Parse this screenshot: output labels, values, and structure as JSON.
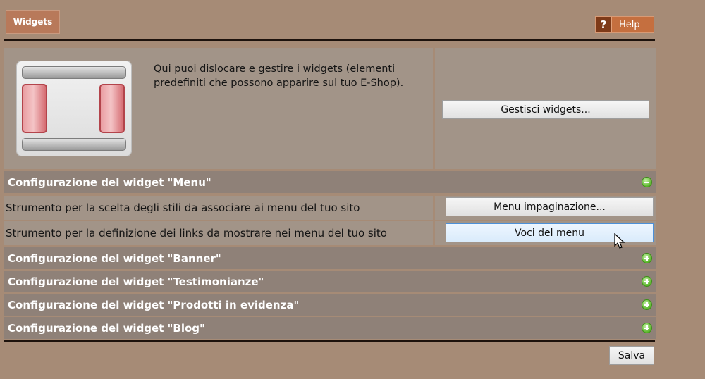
{
  "header": {
    "tab_label": "Widgets",
    "help_label": "Help",
    "help_glyph": "?"
  },
  "intro": {
    "description": "Qui puoi dislocare e gestire i widgets (elementi predefiniti che possono apparire sul tuo E-Shop).",
    "manage_button": "Gestisci widgets..."
  },
  "sections": [
    {
      "title": "Configurazione del widget \"Menu\"",
      "state": "expanded",
      "rows": [
        {
          "text": "Strumento per la scelta degli stili da associare ai menu del tuo sito",
          "button": "Menu impaginazione..."
        },
        {
          "text": "Strumento per la definizione dei links da mostrare nei menu del tuo sito",
          "button": "Voci del menu"
        }
      ]
    },
    {
      "title": "Configurazione del widget \"Banner\"",
      "state": "collapsed"
    },
    {
      "title": "Configurazione del widget \"Testimonianze\"",
      "state": "collapsed"
    },
    {
      "title": "Configurazione del widget \"Prodotti in evidenza\"",
      "state": "collapsed"
    },
    {
      "title": "Configurazione del widget \"Blog\"",
      "state": "collapsed"
    }
  ],
  "footer": {
    "save_label": "Salva"
  },
  "colors": {
    "background": "#a68b76",
    "panel": "#a29488",
    "section_header": "#8f8178",
    "accent": "#c56f3f"
  }
}
